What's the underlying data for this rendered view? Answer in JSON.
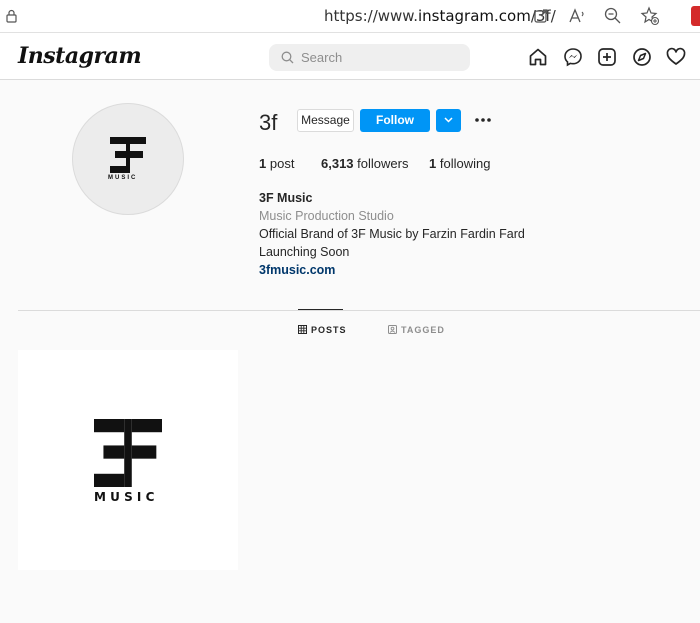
{
  "browser": {
    "url_prefix": "https://www.",
    "url_host": "instagram.com",
    "url_path": "/3f/"
  },
  "header": {
    "logo": "Instagram",
    "search_placeholder": "Search"
  },
  "profile": {
    "username": "3f",
    "avatar_text": "MUSIC",
    "message_label": "Message",
    "follow_label": "Follow",
    "posts_count": "1",
    "posts_label": "post",
    "followers_count": "6,313",
    "followers_label": "followers",
    "following_count": "1",
    "following_label": "following"
  },
  "bio": {
    "name": "3F Music",
    "category": "Music Production Studio",
    "line1": "Official Brand of 3F Music by Farzin Fardin Fard",
    "line2": "Launching Soon",
    "link": "3fmusic.com"
  },
  "tabs": {
    "posts": "POSTS",
    "tagged": "TAGGED"
  },
  "post": {
    "text": "MUSIC"
  },
  "colors": {
    "accent": "#0095f6",
    "link": "#00376b",
    "muted": "#8e8e8e"
  }
}
